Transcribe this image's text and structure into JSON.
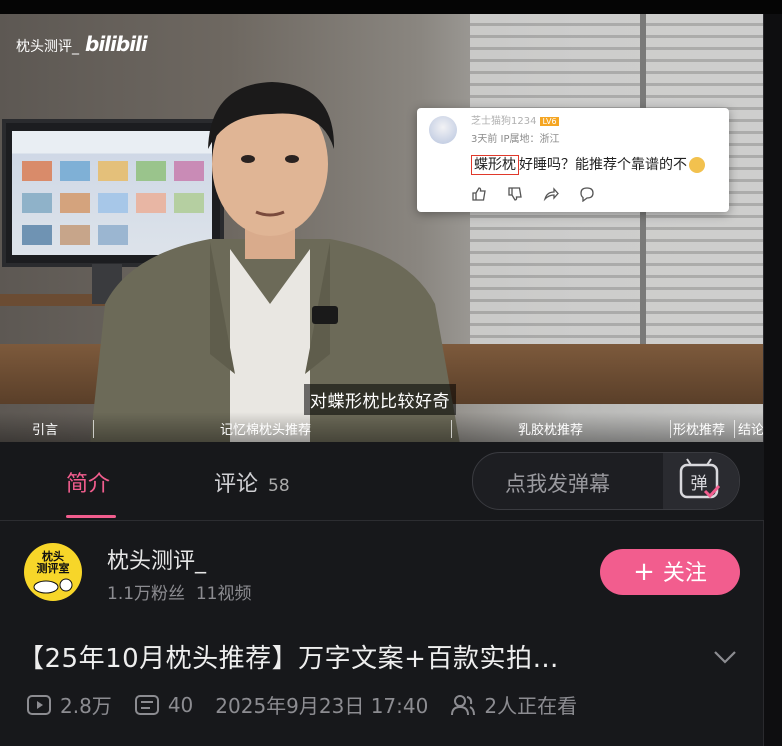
{
  "video": {
    "watermark_user": "枕头测评_",
    "watermark_logo": "bilibili",
    "subtitle": "对蝶形枕比较好奇",
    "comment_card": {
      "username": "芝士猫狗1234",
      "level": "LV6",
      "meta": "3天前 IP属地：浙江",
      "text_highlight": "蝶形枕",
      "text_rest": "好睡吗？能推荐个靠谱的不"
    },
    "chapters": [
      "引言",
      "记忆棉枕头推荐",
      "乳胶枕推荐",
      "形枕推荐",
      "结论"
    ]
  },
  "tabs": {
    "intro": "简介",
    "comments": "评论",
    "comments_count": "58",
    "danmaku_placeholder": "点我发弹幕",
    "danmaku_icon": "弹"
  },
  "author": {
    "avatar_text_1": "枕头",
    "avatar_text_2": "测评室",
    "name": "枕头测评_",
    "followers": "1.1万粉丝",
    "videos": "11视频",
    "follow_plus": "+",
    "follow_label": "关注"
  },
  "title": "【25年10月枕头推荐】万字文案+百款实拍…",
  "stats": {
    "views": "2.8万",
    "danmaku": "40",
    "datetime": "2025年9月23日 17:40",
    "watching": "2人正在看"
  },
  "colors": {
    "accent": "#f25d8e",
    "background": "#17181b"
  }
}
